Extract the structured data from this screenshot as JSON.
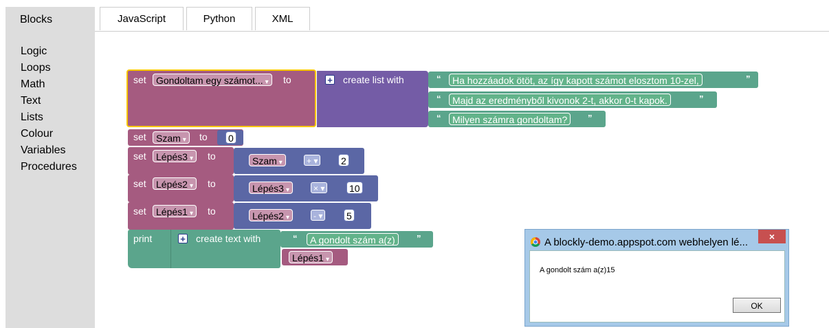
{
  "sidebar": {
    "title": "Blocks",
    "items": [
      {
        "label": "Logic"
      },
      {
        "label": "Loops"
      },
      {
        "label": "Math"
      },
      {
        "label": "Text"
      },
      {
        "label": "Lists"
      },
      {
        "label": "Colour"
      },
      {
        "label": "Variables"
      },
      {
        "label": "Procedures"
      }
    ]
  },
  "tabs": [
    {
      "label": "JavaScript"
    },
    {
      "label": "Python"
    },
    {
      "label": "XML"
    }
  ],
  "blocks": {
    "kw_set": "set",
    "kw_to": "to",
    "kw_print": "print",
    "create_list": "create list with",
    "create_text": "create text with",
    "var_gondoltam": "Gondoltam egy számot...",
    "str1": "Ha hozzáadok ötöt, az így kapott számot elosztom 10-zel,",
    "str2": "Majd az eredményből kivonok 2-t, akkor 0-t kapok.",
    "str3": "Milyen számra gondoltam?",
    "var_szam": "Szam",
    "num_0": "0",
    "var_lepes3": "Lépés3",
    "op_plus": "+",
    "num_2": "2",
    "var_lepes2": "Lépés2",
    "op_times": "×",
    "num_10": "10",
    "var_lepes1": "Lépés1",
    "op_minus": "-",
    "num_5": "5",
    "str_print": "A gondolt szám a(z)",
    "quote_open": "“",
    "quote_close": "”"
  },
  "dialog": {
    "title": "A blockly-demo.appspot.com webhelyen lé...",
    "message": "A gondolt szám a(z)15",
    "ok_label": "OK",
    "close_label": "×"
  },
  "colors": {
    "variables": "#a55b80",
    "lists": "#745ca6",
    "text": "#5ba58c",
    "math": "#5b67a5",
    "selected": "#f9c700"
  }
}
